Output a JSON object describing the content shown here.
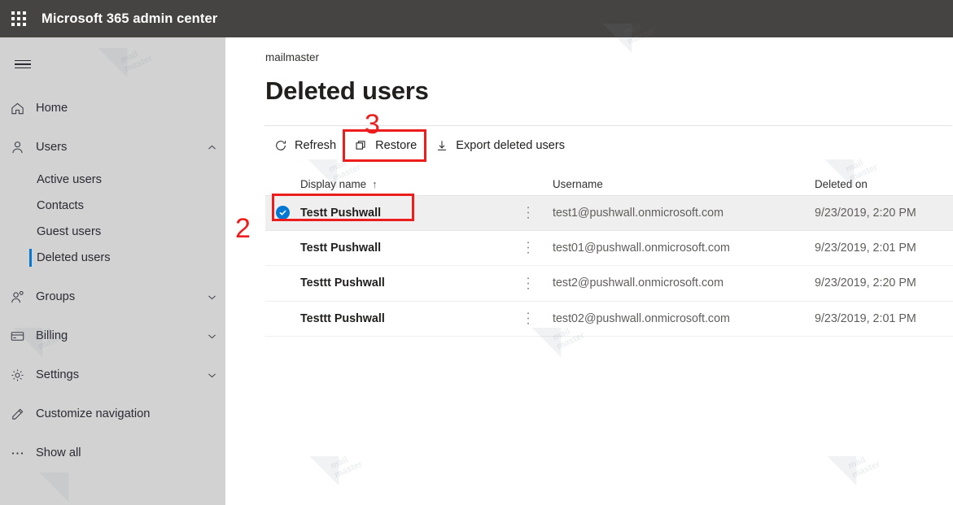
{
  "suitebar": {
    "waffle_icon": "app-launcher-waffle-icon",
    "title": "Microsoft 365 admin center"
  },
  "sidebar": {
    "hamburger_icon": "hamburger-menu-icon",
    "items": [
      {
        "label": "Home",
        "icon": "home-icon",
        "chevron": "",
        "type": "top"
      },
      {
        "label": "Users",
        "icon": "user-icon",
        "chevron": "chevron-up-icon",
        "type": "top"
      },
      {
        "label": "Active users",
        "type": "sub",
        "active": false
      },
      {
        "label": "Contacts",
        "type": "sub",
        "active": false
      },
      {
        "label": "Guest users",
        "type": "sub",
        "active": false
      },
      {
        "label": "Deleted users",
        "type": "sub",
        "active": true
      },
      {
        "label": "Groups",
        "icon": "groups-icon",
        "chevron": "chevron-down-icon",
        "type": "top"
      },
      {
        "label": "Billing",
        "icon": "billing-card-icon",
        "chevron": "chevron-down-icon",
        "type": "top"
      },
      {
        "label": "Settings",
        "icon": "gear-icon",
        "chevron": "chevron-down-icon",
        "type": "top"
      },
      {
        "label": "Customize navigation",
        "icon": "pencil-icon",
        "chevron": "",
        "type": "top"
      },
      {
        "label": "Show all",
        "icon": "ellipsis-icon",
        "chevron": "",
        "type": "top"
      }
    ],
    "active_accent_color": "#0078d4",
    "background_color": "#d2d2d2"
  },
  "main": {
    "breadcrumb": "mailmaster",
    "page_title": "Deleted users",
    "toolbar": {
      "refresh_label": "Refresh",
      "refresh_icon": "refresh-circular-arrow-icon",
      "restore_label": "Restore",
      "restore_icon": "restore-copy-icon",
      "export_label": "Export deleted users",
      "export_icon": "download-arrow-icon"
    },
    "table": {
      "columns": {
        "display_name": "Display name",
        "sort_indicator": "↑",
        "username": "Username",
        "deleted_on": "Deleted on"
      },
      "row_menu_icon": "kebab-menu-icon",
      "rows": [
        {
          "selected": true,
          "display_name": "Testt Pushwall",
          "username": "test1@pushwall.onmicrosoft.com",
          "deleted_on": "9/23/2019, 2:20 PM"
        },
        {
          "selected": false,
          "display_name": "Testt Pushwall",
          "username": "test01@pushwall.onmicrosoft.com",
          "deleted_on": "9/23/2019, 2:01 PM"
        },
        {
          "selected": false,
          "display_name": "Testtt Pushwall",
          "username": "test2@pushwall.onmicrosoft.com",
          "deleted_on": "9/23/2019, 2:20 PM"
        },
        {
          "selected": false,
          "display_name": "Testtt Pushwall",
          "username": "test02@pushwall.onmicrosoft.com",
          "deleted_on": "9/23/2019, 2:01 PM"
        }
      ]
    }
  },
  "annotations": {
    "step_two": "2",
    "step_three": "3",
    "color": "#ee1d1d"
  },
  "watermark": {
    "line1": "mail",
    "line2": "master"
  }
}
